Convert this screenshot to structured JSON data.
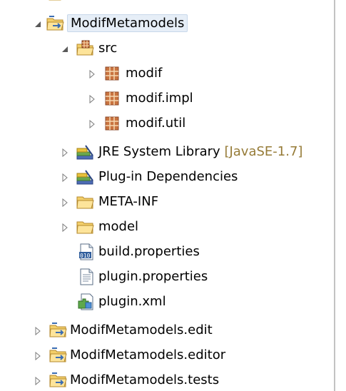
{
  "tree": {
    "root": {
      "label": "ModifMetamodels",
      "icon": "project-folder-icon",
      "expanded": true,
      "selected": true,
      "children": {
        "src": {
          "label": "src",
          "icon": "source-folder-icon",
          "expanded": true,
          "packages": [
            {
              "label": "modif",
              "icon": "package-icon"
            },
            {
              "label": "modif.impl",
              "icon": "package-icon"
            },
            {
              "label": "modif.util",
              "icon": "package-icon"
            }
          ]
        },
        "jre": {
          "label": "JRE System Library",
          "decoration": "[JavaSE-1.7]",
          "icon": "library-icon"
        },
        "plugin_deps": {
          "label": "Plug-in Dependencies",
          "icon": "library-icon"
        },
        "meta_inf": {
          "label": "META-INF",
          "icon": "folder-icon"
        },
        "model": {
          "label": "model",
          "icon": "folder-icon"
        },
        "build_properties": {
          "label": "build.properties",
          "icon": "properties-file-icon"
        },
        "plugin_properties": {
          "label": "plugin.properties",
          "icon": "text-file-icon"
        },
        "plugin_xml": {
          "label": "plugin.xml",
          "icon": "plugin-xml-icon"
        }
      }
    },
    "projects": [
      {
        "label": "ModifMetamodels.edit",
        "icon": "project-folder-icon"
      },
      {
        "label": "ModifMetamodels.editor",
        "icon": "project-folder-icon"
      },
      {
        "label": "ModifMetamodels.tests",
        "icon": "project-folder-icon"
      }
    ]
  },
  "colors": {
    "selection": "#e6eef7",
    "decoration": "#967b37",
    "folder": "#f3cf6a",
    "package": "#8b4a2b",
    "library_book": "#4d6bb4"
  }
}
